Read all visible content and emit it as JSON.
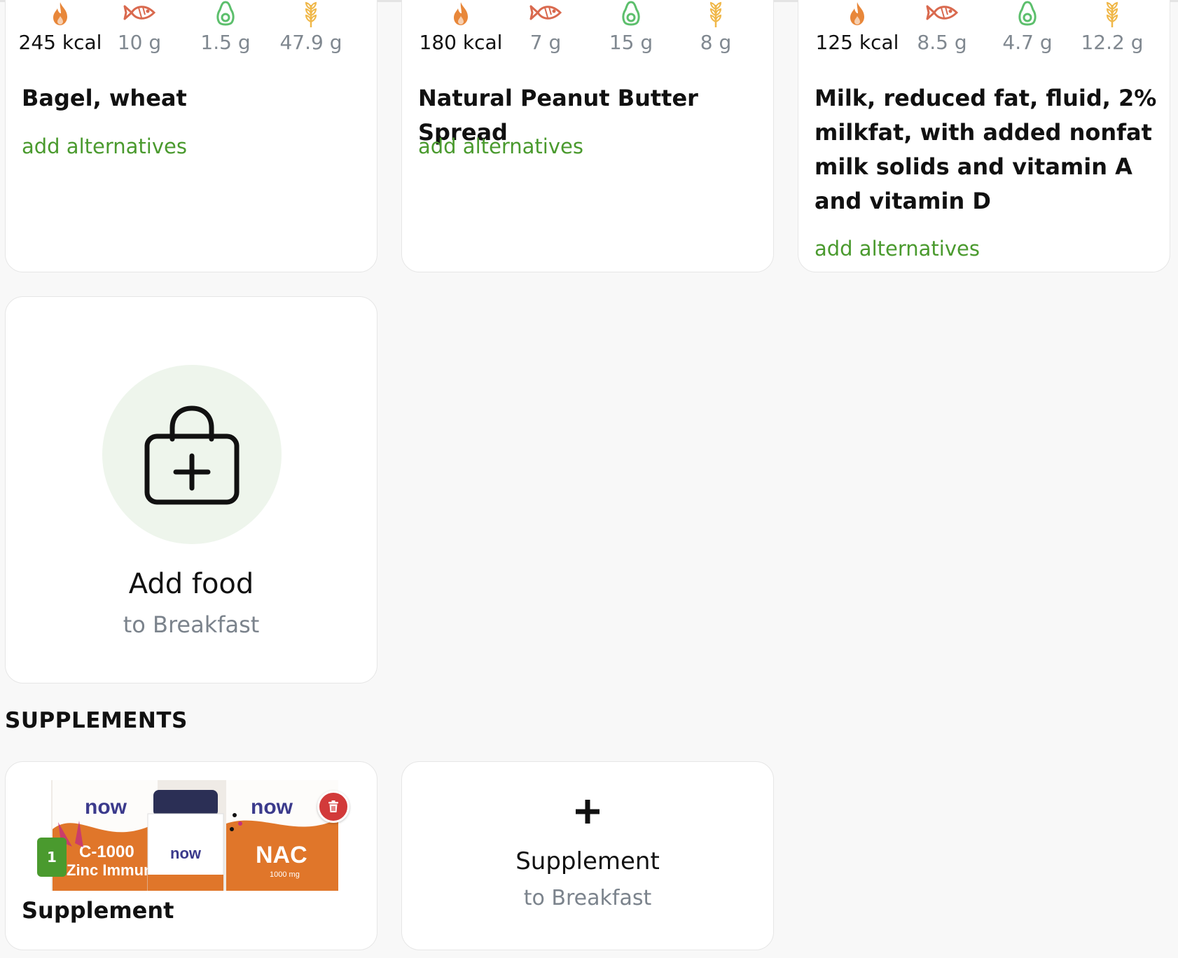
{
  "foods": [
    {
      "name": "Bagel, wheat",
      "alternatives_label": "add alternatives",
      "nutrients": {
        "energy": "245 kcal",
        "protein": "10 g",
        "fat": "1.5 g",
        "carbs": "47.9 g"
      }
    },
    {
      "name": "Natural Peanut Butter Spread",
      "alternatives_label": "add alternatives",
      "nutrients": {
        "energy": "180 kcal",
        "protein": "7 g",
        "fat": "15 g",
        "carbs": "8 g"
      }
    },
    {
      "name": "Milk, reduced fat, fluid, 2% milkfat, with added nonfat milk solids and vitamin A and vitamin D",
      "alternatives_label": "add alternatives",
      "nutrients": {
        "energy": "125 kcal",
        "protein": "8.5 g",
        "fat": "4.7 g",
        "carbs": "12.2 g"
      }
    }
  ],
  "nutrient_icons": {
    "energy": "flame-icon",
    "protein": "fish-icon",
    "fat": "avocado-icon",
    "carbs": "wheat-icon"
  },
  "add_food": {
    "title": "Add food",
    "subtitle": "to Breakfast",
    "icon": "shopping-bag-plus-icon"
  },
  "supplements_section": {
    "title": "SUPPLEMENTS",
    "items": [
      {
        "name": "Supplement",
        "count": "1",
        "image_text": [
          "C-1000",
          "Zinc Immune",
          "NAC",
          "1000 mg"
        ]
      }
    ],
    "add": {
      "title": "Supplement",
      "subtitle": "to Breakfast"
    }
  },
  "colors": {
    "energy": "#e8873a",
    "protein": "#d9694e",
    "fat": "#5cbf6c",
    "carbs": "#f0b84a",
    "link": "#4a9a2e",
    "badge": "#4a9a2e",
    "delete": "#d23a3a",
    "muted_text": "#7b838c"
  }
}
